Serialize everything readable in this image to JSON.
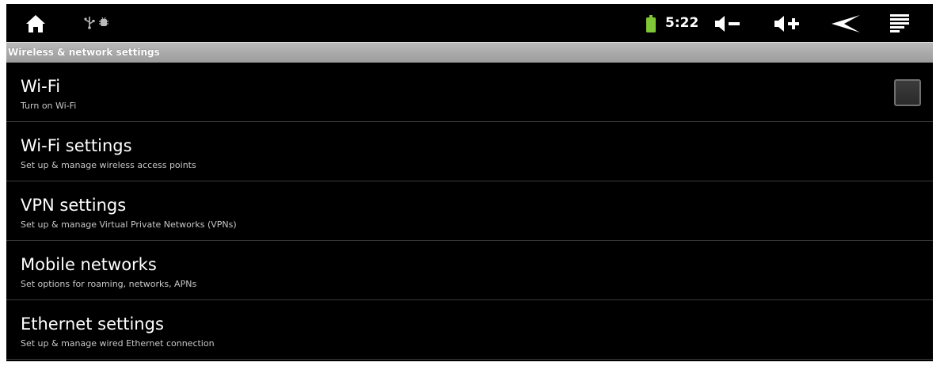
{
  "status_bar": {
    "time": "5:22",
    "icons": [
      "home-icon",
      "usb-icon",
      "usb-debugging-icon",
      "battery-icon",
      "volume-down-icon",
      "volume-up-icon",
      "back-icon",
      "menu-icon"
    ],
    "battery_color": "#7ec636"
  },
  "header": {
    "title": "Wireless & network settings"
  },
  "settings": [
    {
      "title": "Wi-Fi",
      "summary": "Turn on Wi-Fi",
      "has_checkbox": true,
      "checked": false
    },
    {
      "title": "Wi-Fi settings",
      "summary": "Set up & manage wireless access points"
    },
    {
      "title": "VPN settings",
      "summary": "Set up & manage Virtual Private Networks (VPNs)"
    },
    {
      "title": "Mobile networks",
      "summary": "Set options for roaming, networks, APNs"
    },
    {
      "title": "Ethernet settings",
      "summary": "Set up & manage wired Ethernet connection"
    }
  ]
}
